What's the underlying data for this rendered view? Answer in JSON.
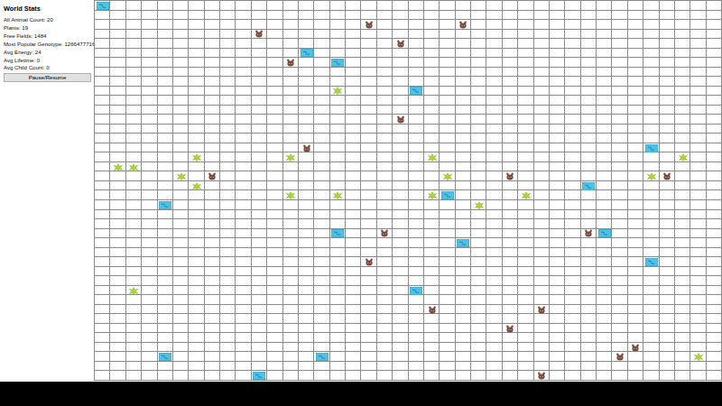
{
  "stats": {
    "title": "World Stats",
    "lines": [
      "All Animal Count: 20",
      "Plants: 19",
      "Free Fields: 1484",
      "Most Popular Genotype: 1266477716",
      "Avg Energy: 24",
      "Avg Lifetime: 0",
      "Avg Child Count: 0"
    ],
    "button": "Pause/Resume"
  },
  "world": {
    "cols": 40,
    "rows": 40,
    "cells": [
      {
        "kind": "water",
        "col": 0,
        "row": 0
      },
      {
        "kind": "water",
        "col": 13,
        "row": 5
      },
      {
        "kind": "water",
        "col": 15,
        "row": 6
      },
      {
        "kind": "water",
        "col": 20,
        "row": 9
      },
      {
        "kind": "water",
        "col": 35,
        "row": 15
      },
      {
        "kind": "water",
        "col": 31,
        "row": 19
      },
      {
        "kind": "water",
        "col": 22,
        "row": 20
      },
      {
        "kind": "water",
        "col": 4,
        "row": 21
      },
      {
        "kind": "water",
        "col": 15,
        "row": 24
      },
      {
        "kind": "water",
        "col": 23,
        "row": 25
      },
      {
        "kind": "water",
        "col": 32,
        "row": 24
      },
      {
        "kind": "water",
        "col": 35,
        "row": 27
      },
      {
        "kind": "water",
        "col": 20,
        "row": 30
      },
      {
        "kind": "water",
        "col": 4,
        "row": 37
      },
      {
        "kind": "water",
        "col": 14,
        "row": 37
      },
      {
        "kind": "water",
        "col": 10,
        "row": 39
      },
      {
        "kind": "animal",
        "col": 17,
        "row": 2
      },
      {
        "kind": "animal",
        "col": 23,
        "row": 2
      },
      {
        "kind": "animal",
        "col": 10,
        "row": 3
      },
      {
        "kind": "animal",
        "col": 19,
        "row": 4
      },
      {
        "kind": "animal",
        "col": 12,
        "row": 6
      },
      {
        "kind": "animal",
        "col": 19,
        "row": 12
      },
      {
        "kind": "animal",
        "col": 13,
        "row": 15
      },
      {
        "kind": "animal",
        "col": 7,
        "row": 18
      },
      {
        "kind": "animal",
        "col": 26,
        "row": 18
      },
      {
        "kind": "animal",
        "col": 36,
        "row": 18
      },
      {
        "kind": "animal",
        "col": 18,
        "row": 24
      },
      {
        "kind": "animal",
        "col": 31,
        "row": 24
      },
      {
        "kind": "animal",
        "col": 17,
        "row": 27
      },
      {
        "kind": "animal",
        "col": 21,
        "row": 32
      },
      {
        "kind": "animal",
        "col": 28,
        "row": 32
      },
      {
        "kind": "animal",
        "col": 26,
        "row": 34
      },
      {
        "kind": "animal",
        "col": 34,
        "row": 36
      },
      {
        "kind": "animal",
        "col": 33,
        "row": 37
      },
      {
        "kind": "animal",
        "col": 28,
        "row": 39
      },
      {
        "kind": "plant",
        "col": 15,
        "row": 9
      },
      {
        "kind": "plant",
        "col": 6,
        "row": 16
      },
      {
        "kind": "plant",
        "col": 12,
        "row": 16
      },
      {
        "kind": "plant",
        "col": 21,
        "row": 16
      },
      {
        "kind": "plant",
        "col": 37,
        "row": 16
      },
      {
        "kind": "plant",
        "col": 1,
        "row": 17
      },
      {
        "kind": "plant",
        "col": 2,
        "row": 17
      },
      {
        "kind": "plant",
        "col": 5,
        "row": 18
      },
      {
        "kind": "plant",
        "col": 22,
        "row": 18
      },
      {
        "kind": "plant",
        "col": 35,
        "row": 18
      },
      {
        "kind": "plant",
        "col": 6,
        "row": 19
      },
      {
        "kind": "plant",
        "col": 12,
        "row": 20
      },
      {
        "kind": "plant",
        "col": 15,
        "row": 20
      },
      {
        "kind": "plant",
        "col": 21,
        "row": 20
      },
      {
        "kind": "plant",
        "col": 27,
        "row": 20
      },
      {
        "kind": "plant",
        "col": 24,
        "row": 21
      },
      {
        "kind": "plant",
        "col": 2,
        "row": 30
      },
      {
        "kind": "plant",
        "col": 38,
        "row": 37
      }
    ]
  }
}
